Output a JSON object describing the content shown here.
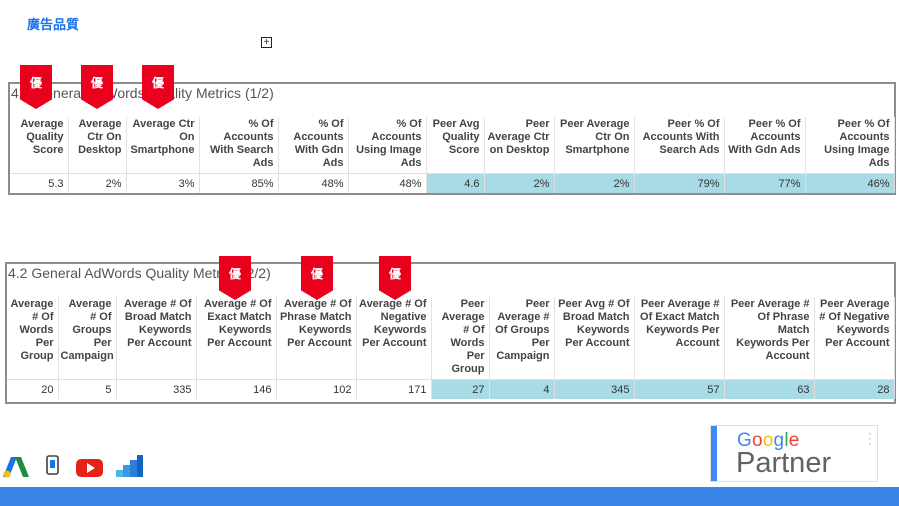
{
  "page": {
    "title": "廣告品質"
  },
  "panel1": {
    "title": "4.1 General AdWords Quality Metrics (1/2)",
    "headers": [
      "Average Quality Score",
      "Average Ctr On Desktop",
      "Average Ctr On Smartphone",
      "% Of Accounts With Search Ads",
      "% Of Accounts With Gdn Ads",
      "% Of Accounts Using Image Ads",
      "Peer Avg Quality Score",
      "Peer Average Ctr on Desktop",
      "Peer Average Ctr On Smartphone",
      "Peer % Of Accounts With Search Ads",
      "Peer % Of Accounts With Gdn Ads",
      "Peer % Of Accounts Using Image Ads"
    ],
    "values": [
      "5.3",
      "2%",
      "3%",
      "85%",
      "48%",
      "48%",
      "4.6",
      "2%",
      "2%",
      "79%",
      "77%",
      "46%"
    ]
  },
  "panel2": {
    "title": "4.2 General AdWords Quality Metrics (2/2)",
    "headers": [
      "Average # Of Words Per Group",
      "Average # Of Groups Per Campaign",
      "Average # Of Broad Match Keywords Per Account",
      "Average # Of Exact Match Keywords Per Account",
      "Average # Of Phrase Match Keywords Per Account",
      "Average # Of Negative Keywords Per Account",
      "Peer Average # Of Words Per Group",
      "Peer Average # Of Groups Per Campaign",
      "Peer Avg # Of Broad Match Keywords Per Account",
      "Peer Average # Of Exact Match Keywords Per Account",
      "Peer Average # Of Phrase Match Keywords Per Account",
      "Peer Average # Of Negative Keywords Per Account"
    ],
    "values": [
      "20",
      "5",
      "335",
      "146",
      "102",
      "171",
      "27",
      "4",
      "345",
      "57",
      "63",
      "28"
    ]
  },
  "badges": {
    "label": "優"
  },
  "partner": {
    "google": "Google",
    "word": "Partner"
  },
  "icons": [
    "google-ads-icon",
    "mobile-app-icon",
    "youtube-icon",
    "analytics-icon"
  ],
  "colors": {
    "peer_cell": "#a8dbe5",
    "badge": "#e8001c",
    "footer_bar": "#3a86e8"
  }
}
